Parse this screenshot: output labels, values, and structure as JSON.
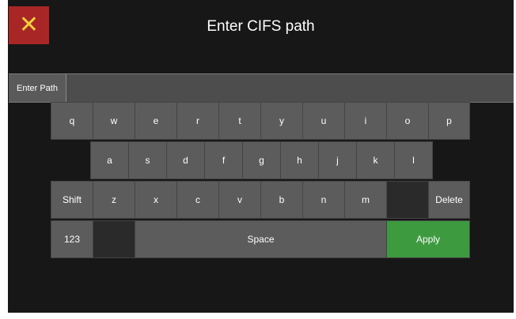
{
  "title": "Enter CIFS path",
  "close_icon": "close-icon",
  "path": {
    "label": "Enter Path",
    "value": "",
    "placeholder": ""
  },
  "keys": {
    "row1": [
      "q",
      "w",
      "e",
      "r",
      "t",
      "y",
      "u",
      "i",
      "o",
      "p"
    ],
    "row2": [
      "a",
      "s",
      "d",
      "f",
      "g",
      "h",
      "j",
      "k",
      "l"
    ],
    "row3": [
      "z",
      "x",
      "c",
      "v",
      "b",
      "n",
      "m"
    ],
    "shift": "Shift",
    "delete": "Delete",
    "num": "123",
    "space": "Space",
    "apply": "Apply"
  },
  "colors": {
    "close_bg": "#a82626",
    "close_icon": "#f4d03f",
    "apply_bg": "#3e9a3e",
    "key_bg": "#5c5c5c"
  }
}
